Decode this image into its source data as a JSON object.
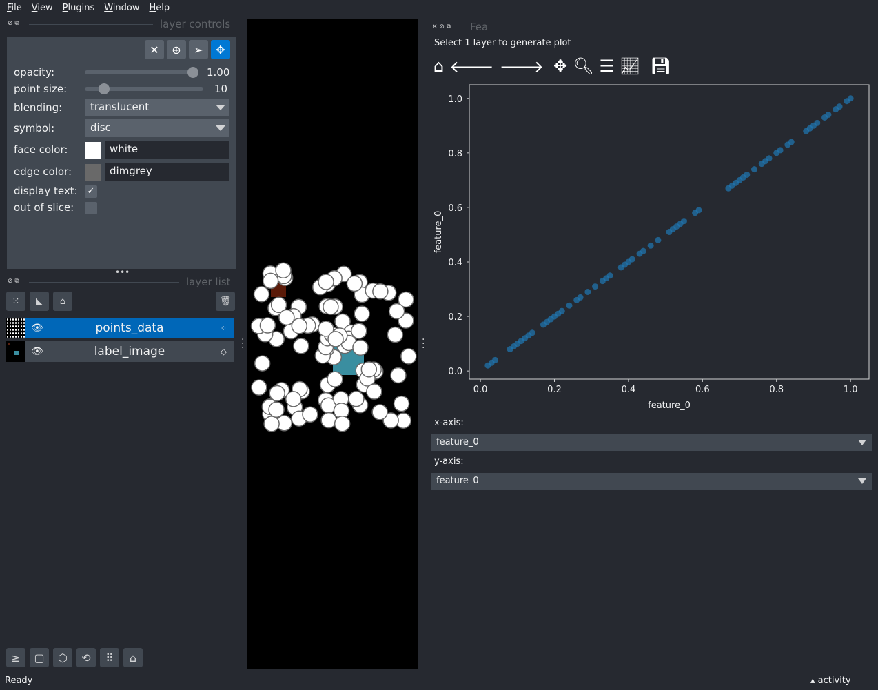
{
  "menu": [
    "File",
    "View",
    "Plugins",
    "Window",
    "Help"
  ],
  "layer_controls": {
    "title": "layer controls",
    "tools": [
      {
        "icon": "close-icon"
      },
      {
        "icon": "add-point-icon"
      },
      {
        "icon": "select-icon"
      },
      {
        "icon": "pan-zoom-icon",
        "active": true
      }
    ],
    "opacity": {
      "label": "opacity:",
      "value": "1.00",
      "fraction": 1.0
    },
    "point_size": {
      "label": "point size:",
      "value": "10",
      "fraction": 0.13
    },
    "blending": {
      "label": "blending:",
      "value": "translucent"
    },
    "symbol": {
      "label": "symbol:",
      "value": "disc"
    },
    "face_color": {
      "label": "face color:",
      "value": "white",
      "swatch": "#ffffff"
    },
    "edge_color": {
      "label": "edge color:",
      "value": "dimgrey",
      "swatch": "#696969"
    },
    "display_text": {
      "label": "display text:",
      "checked": true,
      "check": "✓"
    },
    "out_of_slice": {
      "label": "out of slice:",
      "checked": false
    }
  },
  "layer_list": {
    "title": "layer list",
    "layers": [
      {
        "name": "points_data",
        "selected": true,
        "icon": "points-icon"
      },
      {
        "name": "label_image",
        "selected": false,
        "icon": "label-icon"
      }
    ]
  },
  "plot_panel": {
    "title": "Fea",
    "message": "Select 1 layer to generate plot",
    "x_axis_label": "x-axis:",
    "x_axis_value": "feature_0",
    "y_axis_label": "y-axis:",
    "y_axis_value": "feature_0"
  },
  "chart_data": {
    "type": "scatter",
    "xlabel": "feature_0",
    "ylabel": "feature_0",
    "xlim": [
      -0.03,
      1.05
    ],
    "ylim": [
      -0.03,
      1.05
    ],
    "xticks": [
      "0.0",
      "0.2",
      "0.4",
      "0.6",
      "0.8",
      "1.0"
    ],
    "yticks": [
      "0.0",
      "0.2",
      "0.4",
      "0.6",
      "0.8",
      "1.0"
    ],
    "color": "#1f77b4",
    "x": [
      0.02,
      0.03,
      0.04,
      0.08,
      0.09,
      0.1,
      0.11,
      0.12,
      0.13,
      0.14,
      0.17,
      0.18,
      0.19,
      0.2,
      0.21,
      0.22,
      0.24,
      0.26,
      0.27,
      0.29,
      0.31,
      0.33,
      0.34,
      0.35,
      0.38,
      0.39,
      0.4,
      0.41,
      0.43,
      0.44,
      0.46,
      0.48,
      0.51,
      0.52,
      0.53,
      0.54,
      0.55,
      0.58,
      0.59,
      0.67,
      0.68,
      0.69,
      0.7,
      0.71,
      0.72,
      0.74,
      0.76,
      0.77,
      0.78,
      0.8,
      0.81,
      0.83,
      0.84,
      0.88,
      0.89,
      0.9,
      0.91,
      0.93,
      0.94,
      0.96,
      0.97,
      0.99,
      1.0
    ],
    "y": [
      0.02,
      0.03,
      0.04,
      0.08,
      0.09,
      0.1,
      0.11,
      0.12,
      0.13,
      0.14,
      0.17,
      0.18,
      0.19,
      0.2,
      0.21,
      0.22,
      0.24,
      0.26,
      0.27,
      0.29,
      0.31,
      0.33,
      0.34,
      0.35,
      0.38,
      0.39,
      0.4,
      0.41,
      0.43,
      0.44,
      0.46,
      0.48,
      0.51,
      0.52,
      0.53,
      0.54,
      0.55,
      0.58,
      0.59,
      0.67,
      0.68,
      0.69,
      0.7,
      0.71,
      0.72,
      0.74,
      0.76,
      0.77,
      0.78,
      0.8,
      0.81,
      0.83,
      0.84,
      0.88,
      0.89,
      0.9,
      0.91,
      0.93,
      0.94,
      0.96,
      0.97,
      0.99,
      1.0
    ]
  },
  "status": {
    "text": "Ready",
    "activity": "activity"
  }
}
